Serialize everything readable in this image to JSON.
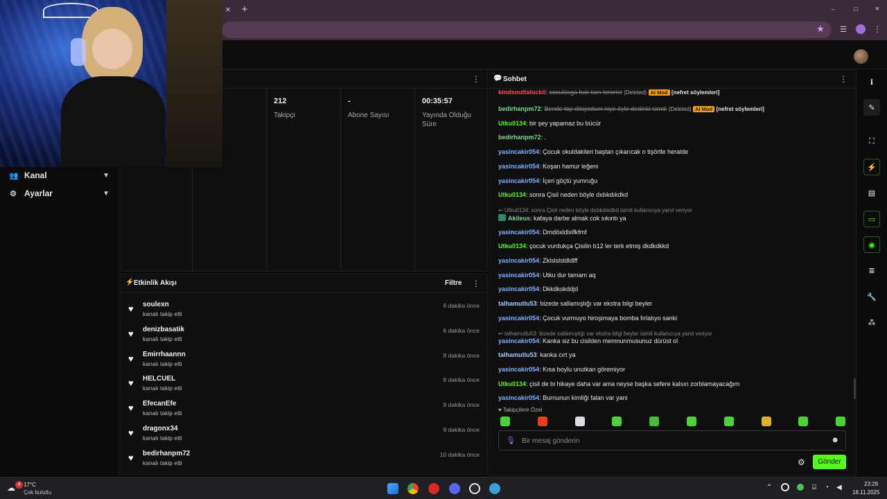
{
  "browser": {
    "close_tab": "×",
    "new_tab": "+",
    "window_controls": [
      "–",
      "□",
      "×"
    ]
  },
  "sidebar": {
    "items": [
      {
        "label": "Kanal",
        "icon": "users-icon"
      },
      {
        "label": "Ayarlar",
        "icon": "gear-icon"
      }
    ]
  },
  "stats": {
    "items": [
      {
        "value": "212",
        "label": "Takipçi"
      },
      {
        "value": "-",
        "label": "Abone Sayısı"
      },
      {
        "value": "00:35:57",
        "label": "Yayında Olduğu Süre"
      }
    ]
  },
  "activity": {
    "title": "Etkinlik Akışı",
    "filter_label": "Filtre",
    "rows": [
      {
        "user": "soulexn",
        "action": "kanalı takip etti",
        "time": "6 dakika önce"
      },
      {
        "user": "denizbasatik",
        "action": "kanalı takip etti",
        "time": "6 dakika önce"
      },
      {
        "user": "Emirrhaannn",
        "action": "kanalı takip etti",
        "time": "8 dakika önce"
      },
      {
        "user": "HELCUEL",
        "action": "kanalı takip etti",
        "time": "8 dakika önce"
      },
      {
        "user": "EfecanEfe",
        "action": "kanalı takip etti",
        "time": "9 dakika önce"
      },
      {
        "user": "dragonx34",
        "action": "kanalı takip etti",
        "time": "9 dakika önce"
      },
      {
        "user": "bedirhanpm72",
        "action": "kanalı takip etti",
        "time": "10 dakika önce"
      }
    ]
  },
  "chat": {
    "title": "Sohbet",
    "messages": [
      {
        "user": "kindsouttaluckii",
        "color": "#ff4d4d",
        "text": "cocuklaga bak tam terorist",
        "deleted": true,
        "extra": "(Deleted)",
        "badge": "AI Mod",
        "tag": "[nefret söylemleri]"
      },
      {
        "user": "bedirhanpm72",
        "color": "#7bd88f",
        "text": "Bende top dikiyodum niye öyle dedinki simdi",
        "deleted": true,
        "extra": "(Deleted)",
        "badge": "AI Mod",
        "tag": "[nefret söylemleri]"
      },
      {
        "user": "Utku0134",
        "color": "#53fc18",
        "text": "bir şey yapamaz bu bücür"
      },
      {
        "user": "bedirhanpm72",
        "color": "#7bd88f",
        "text": "."
      },
      {
        "user": "yasincakir054",
        "color": "#7fb0ff",
        "text": "Çocuk okuldakileri baştan çıkarıcak o tişörtle heralde"
      },
      {
        "user": "yasincakir054",
        "color": "#7fb0ff",
        "text": "Koşan hamur leğeni"
      },
      {
        "user": "yasincakir054",
        "color": "#7fb0ff",
        "text": "İçeri göçtü yumruğu"
      },
      {
        "user": "Utku0134",
        "color": "#53fc18",
        "text": "sonra Çisil neden böyle dıdıkdıkdkd"
      },
      {
        "user": "Akileus",
        "color": "#7bd88f",
        "text": "kafaya darbe almak cok sıkıntı ya",
        "reply": "Utku0134: sonra Çisil neden böyle dıdıkdıkdkd isimli kullanıcıya yanıt veriyor"
      },
      {
        "user": "yasincakir054",
        "color": "#7fb0ff",
        "text": "Dmdöxldlxlfkfmf"
      },
      {
        "user": "Utku0134",
        "color": "#53fc18",
        "text": "çocuk vurdukça Çisilin b12 ler terk etmiş dkdkdkkd"
      },
      {
        "user": "yasincakir054",
        "color": "#7fb0ff",
        "text": "Zklslslsldldlff"
      },
      {
        "user": "yasincakir054",
        "color": "#7fb0ff",
        "text": "Utku dur tamam aq"
      },
      {
        "user": "yasincakir054",
        "color": "#7fb0ff",
        "text": "Dkkdkskddjd"
      },
      {
        "user": "talhamutlu53",
        "color": "#a8c8ff",
        "text": "bizede sallamışlığı var ekstra bilgi beyler"
      },
      {
        "user": "yasincakir054",
        "color": "#7fb0ff",
        "text": "Çocuk vurmuyo hiroşimaya bomba fırlatıyo sanki"
      },
      {
        "user": "yasincakir054",
        "color": "#7fb0ff",
        "text": "Kanka siz bu cisilden memnunmusunuz dürüst ol",
        "reply": "talhamutlu53: bizede sallamışlığı var ekstra bilgi beyler isimli kullanıcıya yanıt veriyor"
      },
      {
        "user": "talhamutlu53",
        "color": "#a8c8ff",
        "text": "kanka cırt ya"
      },
      {
        "user": "yasincakir054",
        "color": "#7fb0ff",
        "text": "Kısa boylu unutkan göremiyor"
      },
      {
        "user": "Utku0134",
        "color": "#53fc18",
        "text": "çisil de bi hikaye daha var ama neyse başka sefere kalsın zorblamayacağım"
      },
      {
        "user": "yasincakir054",
        "color": "#7fb0ff",
        "text": "Burnunun kimliği falan var yani"
      }
    ],
    "followers_only": "Takipçilere Özel",
    "input_placeholder": "Bir mesaj gönderin",
    "send_label": "Gönder"
  },
  "taskbar": {
    "weather_temp": "17°C",
    "weather_desc": "Çok bulutlu",
    "notification_count": "4",
    "time": "23:28",
    "date": "18.11.2025"
  }
}
